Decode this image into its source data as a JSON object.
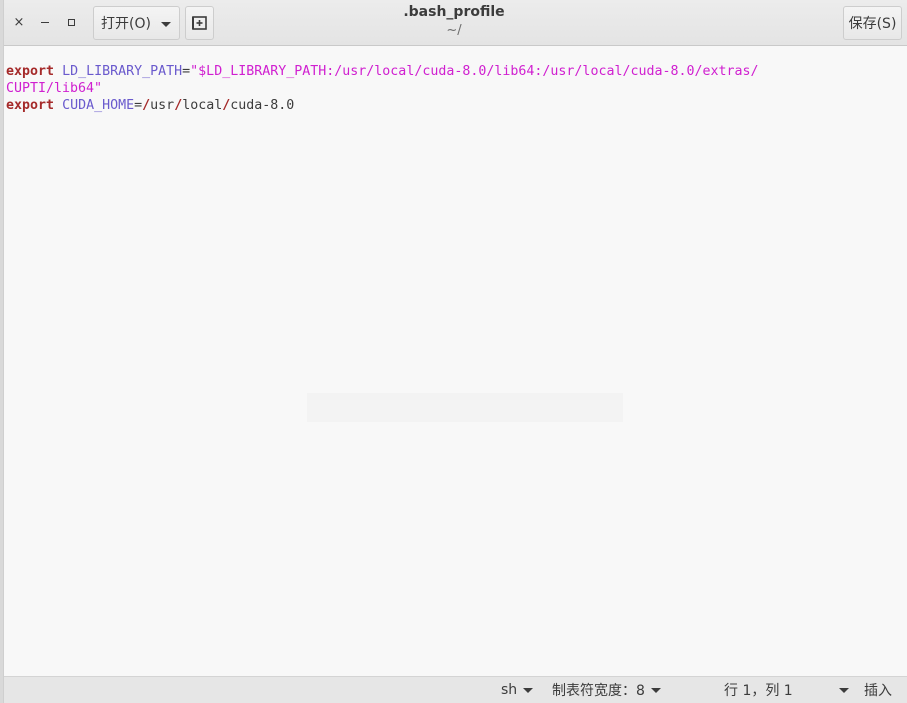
{
  "window": {
    "title": ".bash_profile",
    "subtitle": "~/"
  },
  "headerbar": {
    "close_glyph": "×",
    "open_label": "打开(O)",
    "save_label": "保存(S)",
    "new_tab_icon": "new-document-icon"
  },
  "editor": {
    "lines": [
      {
        "keyword": "export",
        "variable": "LD_LIBRARY_PATH",
        "equals": "=",
        "string_part1": "\"$LD_LIBRARY_PATH:/usr/local/cuda-8.0/lib64:/usr/local/cuda-8.0/extras/",
        "string_part2": "CUPTI/lib64\""
      },
      {
        "keyword": "export",
        "variable": "CUDA_HOME",
        "equals": "=",
        "value_segments": [
          "/",
          "usr",
          "/",
          "local",
          "/",
          "cuda-8.0"
        ]
      }
    ]
  },
  "statusbar": {
    "language": "sh",
    "tab_width": "制表符宽度：8",
    "position": "行 1，列 1",
    "mode": "插入"
  }
}
